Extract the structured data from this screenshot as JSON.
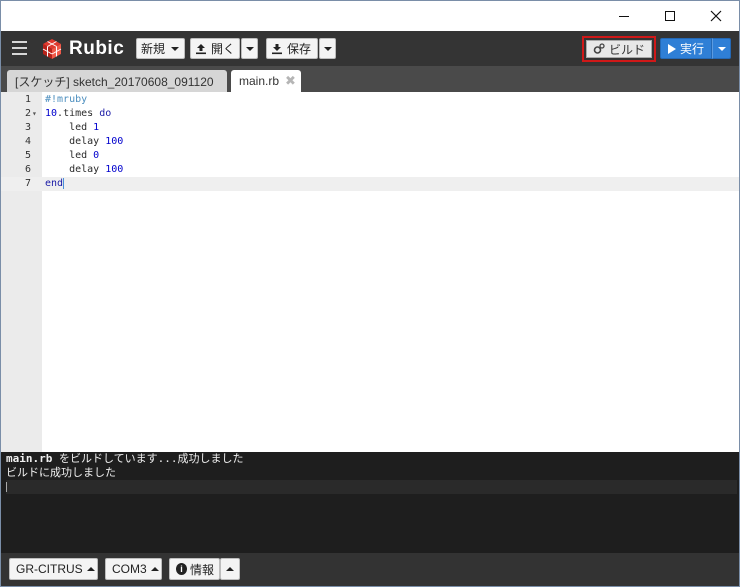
{
  "window": {
    "controls": {
      "minimize": "minimize-icon",
      "maximize": "maximize-icon",
      "close": "close-icon"
    }
  },
  "toolbar": {
    "app_name": "Rubic",
    "new_label": "新規",
    "open_label": "開く",
    "save_label": "保存",
    "build_label": "ビルド",
    "run_label": "実行",
    "icons": {
      "menu": "hamburger-menu-icon",
      "logo": "rubic-cube-icon",
      "open": "upload-icon",
      "save": "download-icon",
      "build": "gears-icon",
      "run": "play-icon"
    }
  },
  "tabs": [
    {
      "label": "[スケッチ] sketch_20170608_091120",
      "active": false
    },
    {
      "label": "main.rb",
      "active": true,
      "close_icon": "close-x-icon"
    }
  ],
  "editor": {
    "language": "ruby",
    "active_line": 7,
    "lines": [
      {
        "number": "1",
        "text": "#!mruby"
      },
      {
        "number": "2",
        "text": "10.times do",
        "foldable": true
      },
      {
        "number": "3",
        "text": "    led 1"
      },
      {
        "number": "4",
        "text": "    delay 100"
      },
      {
        "number": "5",
        "text": "    led 0"
      },
      {
        "number": "6",
        "text": "    delay 100"
      },
      {
        "number": "7",
        "text": "end"
      }
    ]
  },
  "console": {
    "line1_file": "main.rb",
    "line1_rest": " をビルドしています...成功しました",
    "line2": "ビルドに成功しました"
  },
  "statusbar": {
    "board_label": "GR-CITRUS",
    "port_label": "COM3",
    "info_label": "情報",
    "colors": {
      "background": "#333333"
    }
  },
  "colors": {
    "toolbar_bg": "#343434",
    "run_button": "#2f7fd6",
    "build_highlight": "#d01818",
    "console_bg": "#1e1e1e"
  }
}
